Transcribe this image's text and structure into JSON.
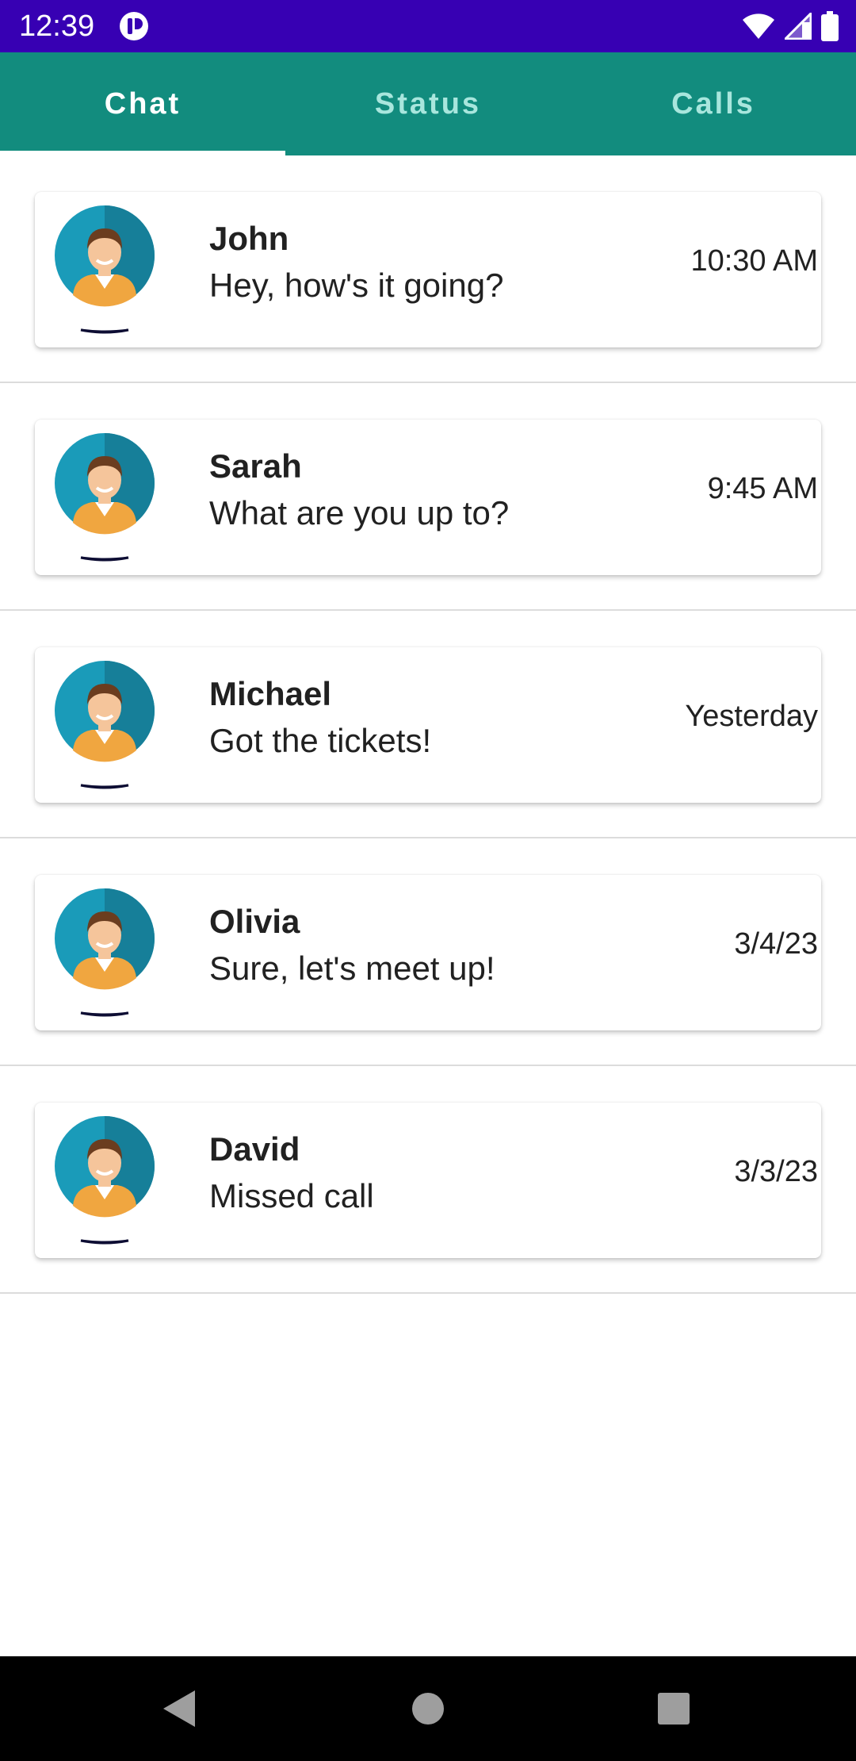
{
  "status_bar": {
    "time": "12:39",
    "icons": [
      "app-notification-icon",
      "wifi-icon",
      "cell-signal-icon",
      "battery-icon"
    ],
    "background": "#3700b3"
  },
  "tabs": [
    {
      "label": "Chat",
      "active": true
    },
    {
      "label": "Status",
      "active": false
    },
    {
      "label": "Calls",
      "active": false
    }
  ],
  "tab_bar_color": "#128c7e",
  "chats": [
    {
      "name": "John",
      "message": "Hey, how's it going?",
      "time": "10:30 AM",
      "avatar": "person-avatar-icon"
    },
    {
      "name": "Sarah",
      "message": "What are you up to?",
      "time": "9:45 AM",
      "avatar": "person-avatar-icon"
    },
    {
      "name": "Michael",
      "message": "Got the tickets!",
      "time": "Yesterday",
      "avatar": "person-avatar-icon"
    },
    {
      "name": "Olivia",
      "message": "Sure, let's meet up!",
      "time": "3/4/23",
      "avatar": "person-avatar-icon"
    },
    {
      "name": "David",
      "message": "Missed call",
      "time": "3/3/23",
      "avatar": "person-avatar-icon"
    }
  ],
  "nav_bar": {
    "buttons": [
      "back-icon",
      "home-icon",
      "recents-icon"
    ]
  }
}
